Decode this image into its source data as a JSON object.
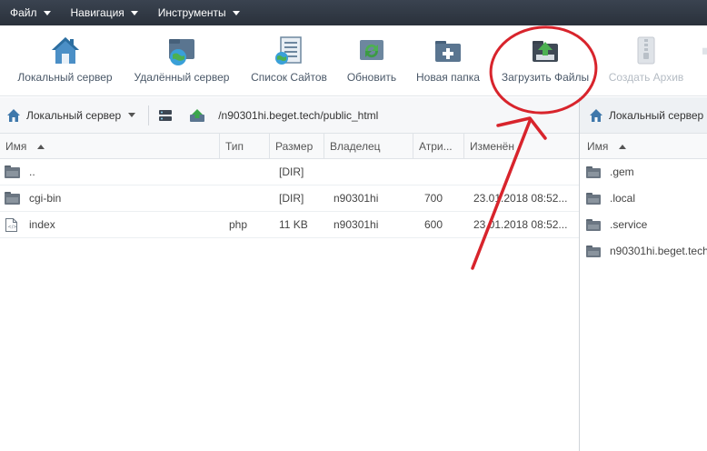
{
  "menubar": {
    "items": [
      {
        "label": "Файл"
      },
      {
        "label": "Навигация"
      },
      {
        "label": "Инструменты"
      }
    ]
  },
  "toolbar": {
    "buttons": [
      {
        "label": "Локальный сервер",
        "icon": "house-icon"
      },
      {
        "label": "Удалённый сервер",
        "icon": "globe-folder-icon"
      },
      {
        "label": "Список Сайтов",
        "icon": "site-list-icon"
      },
      {
        "label": "Обновить",
        "icon": "refresh-icon"
      },
      {
        "label": "Новая папка",
        "icon": "new-folder-icon"
      },
      {
        "label": "Загрузить Файлы",
        "icon": "upload-folder-icon"
      },
      {
        "label": "Создать Архив",
        "icon": "archive-icon",
        "disabled": true
      }
    ]
  },
  "left_panel": {
    "location": "Локальный сервер",
    "path": "/n90301hi.beget.tech/public_html",
    "columns": [
      "Имя",
      "Тип",
      "Размер",
      "Владелец",
      "Атри...",
      "Изменён"
    ],
    "rows": [
      {
        "name": "..",
        "type": "",
        "size": "[DIR]",
        "owner": "",
        "attr": "",
        "modified": "",
        "icon": "folder-icon"
      },
      {
        "name": "cgi-bin",
        "type": "",
        "size": "[DIR]",
        "owner": "n90301hi",
        "attr": "700",
        "modified": "23.01.2018 08:52...",
        "icon": "folder-icon"
      },
      {
        "name": "index",
        "type": "php",
        "size": "11 KB",
        "owner": "n90301hi",
        "attr": "600",
        "modified": "23.01.2018 08:52...",
        "icon": "php-file-icon"
      }
    ]
  },
  "right_panel": {
    "location": "Локальный сервер",
    "columns": [
      "Имя"
    ],
    "rows": [
      {
        "name": ".gem"
      },
      {
        "name": ".local"
      },
      {
        "name": ".service"
      },
      {
        "name": "n90301hi.beget.tech"
      }
    ]
  },
  "annotation": {
    "color": "#d8242c"
  },
  "colors": {
    "menubar": "#2f3742",
    "accent_green": "#3aa64a",
    "accent_blue": "#2c6ea0"
  }
}
